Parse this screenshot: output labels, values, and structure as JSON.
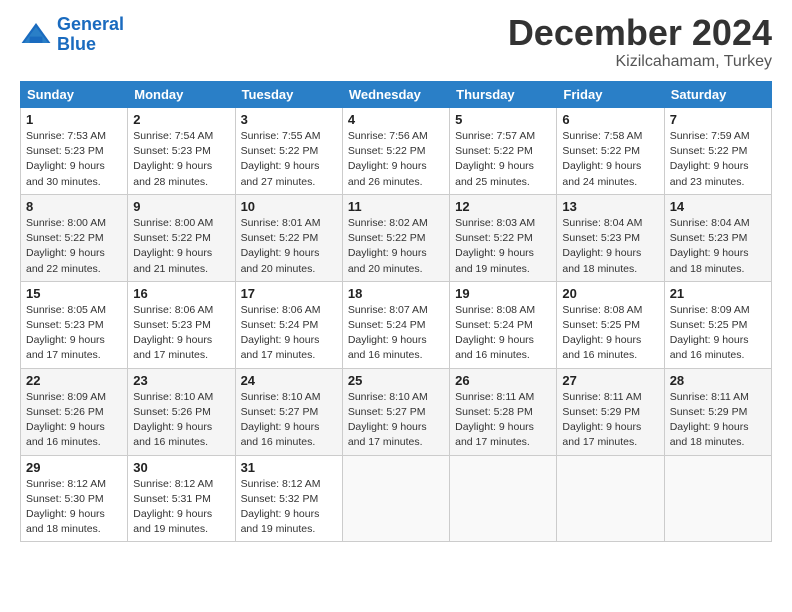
{
  "logo": {
    "line1": "General",
    "line2": "Blue"
  },
  "title": "December 2024",
  "location": "Kizilcahamam, Turkey",
  "days_of_week": [
    "Sunday",
    "Monday",
    "Tuesday",
    "Wednesday",
    "Thursday",
    "Friday",
    "Saturday"
  ],
  "weeks": [
    [
      {
        "day": "1",
        "info": "Sunrise: 7:53 AM\nSunset: 5:23 PM\nDaylight: 9 hours\nand 30 minutes."
      },
      {
        "day": "2",
        "info": "Sunrise: 7:54 AM\nSunset: 5:23 PM\nDaylight: 9 hours\nand 28 minutes."
      },
      {
        "day": "3",
        "info": "Sunrise: 7:55 AM\nSunset: 5:22 PM\nDaylight: 9 hours\nand 27 minutes."
      },
      {
        "day": "4",
        "info": "Sunrise: 7:56 AM\nSunset: 5:22 PM\nDaylight: 9 hours\nand 26 minutes."
      },
      {
        "day": "5",
        "info": "Sunrise: 7:57 AM\nSunset: 5:22 PM\nDaylight: 9 hours\nand 25 minutes."
      },
      {
        "day": "6",
        "info": "Sunrise: 7:58 AM\nSunset: 5:22 PM\nDaylight: 9 hours\nand 24 minutes."
      },
      {
        "day": "7",
        "info": "Sunrise: 7:59 AM\nSunset: 5:22 PM\nDaylight: 9 hours\nand 23 minutes."
      }
    ],
    [
      {
        "day": "8",
        "info": "Sunrise: 8:00 AM\nSunset: 5:22 PM\nDaylight: 9 hours\nand 22 minutes."
      },
      {
        "day": "9",
        "info": "Sunrise: 8:00 AM\nSunset: 5:22 PM\nDaylight: 9 hours\nand 21 minutes."
      },
      {
        "day": "10",
        "info": "Sunrise: 8:01 AM\nSunset: 5:22 PM\nDaylight: 9 hours\nand 20 minutes."
      },
      {
        "day": "11",
        "info": "Sunrise: 8:02 AM\nSunset: 5:22 PM\nDaylight: 9 hours\nand 20 minutes."
      },
      {
        "day": "12",
        "info": "Sunrise: 8:03 AM\nSunset: 5:22 PM\nDaylight: 9 hours\nand 19 minutes."
      },
      {
        "day": "13",
        "info": "Sunrise: 8:04 AM\nSunset: 5:23 PM\nDaylight: 9 hours\nand 18 minutes."
      },
      {
        "day": "14",
        "info": "Sunrise: 8:04 AM\nSunset: 5:23 PM\nDaylight: 9 hours\nand 18 minutes."
      }
    ],
    [
      {
        "day": "15",
        "info": "Sunrise: 8:05 AM\nSunset: 5:23 PM\nDaylight: 9 hours\nand 17 minutes."
      },
      {
        "day": "16",
        "info": "Sunrise: 8:06 AM\nSunset: 5:23 PM\nDaylight: 9 hours\nand 17 minutes."
      },
      {
        "day": "17",
        "info": "Sunrise: 8:06 AM\nSunset: 5:24 PM\nDaylight: 9 hours\nand 17 minutes."
      },
      {
        "day": "18",
        "info": "Sunrise: 8:07 AM\nSunset: 5:24 PM\nDaylight: 9 hours\nand 16 minutes."
      },
      {
        "day": "19",
        "info": "Sunrise: 8:08 AM\nSunset: 5:24 PM\nDaylight: 9 hours\nand 16 minutes."
      },
      {
        "day": "20",
        "info": "Sunrise: 8:08 AM\nSunset: 5:25 PM\nDaylight: 9 hours\nand 16 minutes."
      },
      {
        "day": "21",
        "info": "Sunrise: 8:09 AM\nSunset: 5:25 PM\nDaylight: 9 hours\nand 16 minutes."
      }
    ],
    [
      {
        "day": "22",
        "info": "Sunrise: 8:09 AM\nSunset: 5:26 PM\nDaylight: 9 hours\nand 16 minutes."
      },
      {
        "day": "23",
        "info": "Sunrise: 8:10 AM\nSunset: 5:26 PM\nDaylight: 9 hours\nand 16 minutes."
      },
      {
        "day": "24",
        "info": "Sunrise: 8:10 AM\nSunset: 5:27 PM\nDaylight: 9 hours\nand 16 minutes."
      },
      {
        "day": "25",
        "info": "Sunrise: 8:10 AM\nSunset: 5:27 PM\nDaylight: 9 hours\nand 17 minutes."
      },
      {
        "day": "26",
        "info": "Sunrise: 8:11 AM\nSunset: 5:28 PM\nDaylight: 9 hours\nand 17 minutes."
      },
      {
        "day": "27",
        "info": "Sunrise: 8:11 AM\nSunset: 5:29 PM\nDaylight: 9 hours\nand 17 minutes."
      },
      {
        "day": "28",
        "info": "Sunrise: 8:11 AM\nSunset: 5:29 PM\nDaylight: 9 hours\nand 18 minutes."
      }
    ],
    [
      {
        "day": "29",
        "info": "Sunrise: 8:12 AM\nSunset: 5:30 PM\nDaylight: 9 hours\nand 18 minutes."
      },
      {
        "day": "30",
        "info": "Sunrise: 8:12 AM\nSunset: 5:31 PM\nDaylight: 9 hours\nand 19 minutes."
      },
      {
        "day": "31",
        "info": "Sunrise: 8:12 AM\nSunset: 5:32 PM\nDaylight: 9 hours\nand 19 minutes."
      },
      {
        "day": "",
        "info": ""
      },
      {
        "day": "",
        "info": ""
      },
      {
        "day": "",
        "info": ""
      },
      {
        "day": "",
        "info": ""
      }
    ]
  ]
}
